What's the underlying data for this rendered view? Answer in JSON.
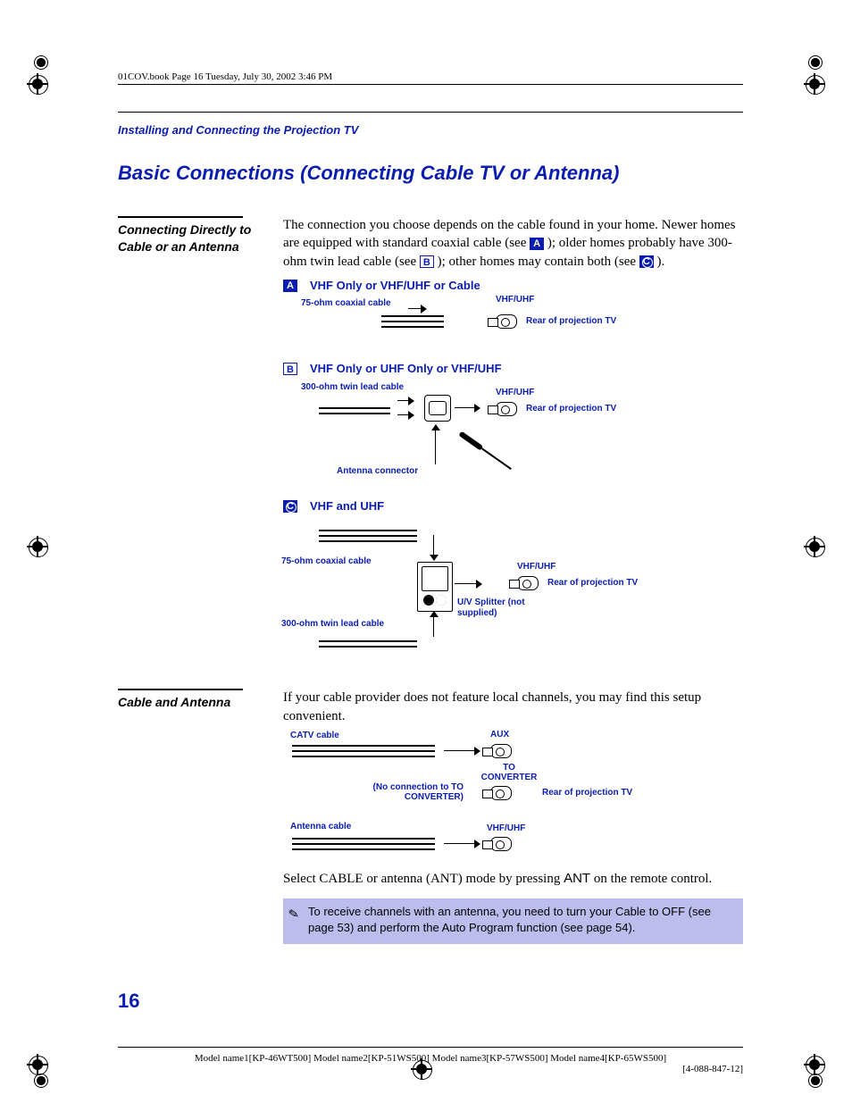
{
  "book_header": "01COV.book  Page 16  Tuesday, July 30, 2002  3:46 PM",
  "section_header": "Installing and Connecting the Projection TV",
  "main_title": "Basic Connections (Connecting Cable TV or Antenna)",
  "sec1": {
    "side_title": "Connecting Directly to Cable or an Antenna",
    "para_1": "The connection you choose depends on the cable found in your home. Newer homes are equipped with standard coaxial cable (see ",
    "para_2": "); older homes probably have 300-ohm twin lead cable (see ",
    "para_3": "); other homes may contain both (see ",
    "para_4": ").",
    "a_label": "A",
    "b_label": "B",
    "c_label": "C",
    "dia_a": {
      "title": "VHF Only or VHF/UHF or Cable",
      "cable_label": "75-ohm coaxial cable",
      "port_label": "VHF/UHF",
      "rear_label": "Rear of projection TV"
    },
    "dia_b": {
      "title": "VHF Only or UHF Only or VHF/UHF",
      "cable_label": "300-ohm twin lead cable",
      "port_label": "VHF/UHF",
      "rear_label": "Rear of projection TV",
      "connector_label": "Antenna connector"
    },
    "dia_c": {
      "title": "VHF and UHF",
      "coax_label": "75-ohm coaxial cable",
      "twin_label": "300-ohm twin lead cable",
      "port_label": "VHF/UHF",
      "rear_label": "Rear of projection TV",
      "splitter_label": "U/V Splitter (not supplied)"
    }
  },
  "sec2": {
    "side_title": "Cable and Antenna",
    "para_1": "If your cable provider does not feature local channels, you may find this setup convenient.",
    "dia": {
      "catv_label": "CATV cable",
      "aux_label": "AUX",
      "to_conv_label": "TO CONVERTER",
      "no_conn_label": "(No connection to TO CONVERTER)",
      "rear_label": "Rear of projection TV",
      "antenna_label": "Antenna cable",
      "vhfuhf_label": "VHF/UHF"
    },
    "para_2a": "Select CABLE or antenna (ANT) mode by pressing ",
    "para_2_ant": "ANT",
    "para_2b": " on the remote control.",
    "note": "To receive channels with an antenna, you need to turn your Cable to OFF (see page 53) and perform the Auto Program function (see page 54)."
  },
  "page_number": "16",
  "footer_models": "Model name1[KP-46WT500]  Model name2[KP-51WS500]  Model name3[KP-57WS500]  Model name4[KP-65WS500]",
  "footer_partnum": "[4-088-847-12]"
}
